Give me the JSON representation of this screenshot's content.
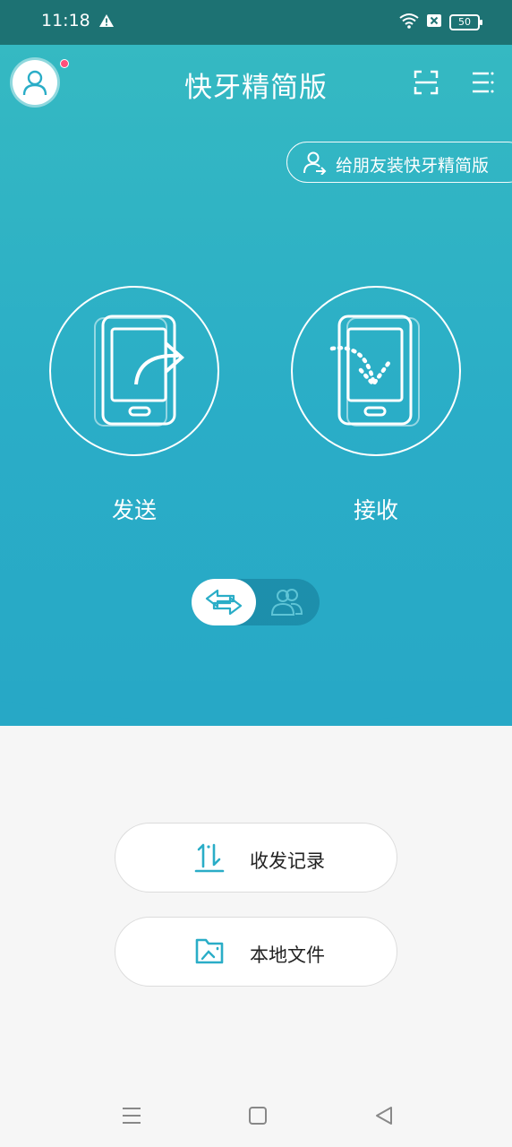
{
  "status_bar": {
    "time": "11:18",
    "battery": "50",
    "icons": [
      "warning-icon",
      "wifi-icon",
      "no-sim-icon",
      "battery-icon"
    ]
  },
  "header": {
    "title": "快牙精简版",
    "icons": [
      "avatar-icon",
      "scan-icon",
      "menu-icon"
    ]
  },
  "invite": {
    "label": "给朋友装快牙精简版",
    "icon": "add-user-icon"
  },
  "actions": {
    "send": {
      "label": "发送",
      "icon": "phone-send-icon"
    },
    "receive": {
      "label": "接收",
      "icon": "phone-receive-icon"
    }
  },
  "mode_toggle": {
    "selected": "transfer",
    "options": [
      "transfer-icon",
      "group-icon"
    ]
  },
  "bottom": {
    "records_label": "收发记录",
    "files_label": "本地文件"
  },
  "nav_bar": {
    "icons": [
      "recent-apps-icon",
      "home-icon",
      "back-icon"
    ]
  },
  "colors": {
    "primary": "#2aadc7",
    "accent_dot": "#ff4f7b",
    "status_bar": "#1d7273"
  }
}
